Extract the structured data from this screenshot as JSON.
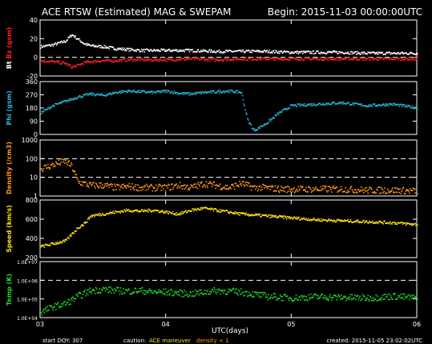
{
  "header": {
    "title": "ACE RTSW (Estimated) MAG & SWEPAM",
    "begin": "Begin: 2015-11-03 00:00:00UTC"
  },
  "footer": {
    "xlabel": "UTC(days)",
    "start_doy": "start DOY: 307",
    "caution_label": "caution:",
    "maneuver_label": "ACE maneuver",
    "density_label": "density < 1",
    "created": "created: 2015-11-05 23:02:02UTC"
  },
  "colors": {
    "background": "#000000",
    "frame": "#ffffff",
    "bz": "#ff2020",
    "bt": "#ffffff",
    "phi": "#29b6d8",
    "density": "#ff9a1a",
    "speed": "#ffe21a",
    "temp": "#22d82b",
    "maneuver": "#ffe21a",
    "density_caution": "#ff9a1a"
  },
  "chart_data": [
    {
      "type": "scatter",
      "panel": "bz-bt",
      "ylabel_parts": [
        "Bt",
        "Bz",
        "(gsm)"
      ],
      "ylabel_colors": [
        "#ffffff",
        "#ff2020",
        "#ff2020"
      ],
      "ylim": [
        -20,
        40
      ],
      "yticks": [
        -20,
        0,
        20,
        40
      ],
      "ytick_labels": [
        "-20",
        "0",
        "20",
        "40"
      ],
      "dashed_lines": [
        0
      ],
      "x": [
        3.0,
        3.1,
        3.2,
        3.25,
        3.3,
        3.35,
        3.4,
        3.5,
        3.6,
        3.7,
        3.8,
        3.9,
        4.0,
        4.2,
        4.4,
        4.6,
        4.8,
        5.0,
        5.2,
        5.4,
        5.6,
        5.8,
        6.0
      ],
      "series": [
        {
          "name": "Bt",
          "values": [
            12,
            14,
            18,
            25,
            20,
            15,
            13,
            12,
            10,
            9,
            8,
            8,
            8,
            8,
            7,
            7,
            7,
            6,
            6,
            6,
            5,
            5,
            5
          ]
        },
        {
          "name": "Bz",
          "values": [
            -3,
            -4,
            -6,
            -10,
            -8,
            -5,
            -4,
            -3,
            -3,
            -2,
            -2,
            -2,
            -2,
            -1,
            -2,
            -1,
            -1,
            -1,
            -1,
            -1,
            -1,
            -1,
            -1
          ]
        }
      ]
    },
    {
      "type": "scatter",
      "panel": "phi",
      "ylabel": "Phi (gsm)",
      "ylim": [
        0,
        360
      ],
      "yticks": [
        0,
        90,
        180,
        270,
        360
      ],
      "ytick_labels": [
        "0",
        "90",
        "180",
        "270",
        "360"
      ],
      "x": [
        3.0,
        3.1,
        3.2,
        3.3,
        3.4,
        3.5,
        3.6,
        3.7,
        3.8,
        3.9,
        4.0,
        4.1,
        4.2,
        4.3,
        4.4,
        4.5,
        4.6,
        4.65,
        4.7,
        4.8,
        4.9,
        5.0,
        5.2,
        5.4,
        5.6,
        5.8,
        6.0
      ],
      "series": [
        {
          "name": "Phi",
          "values": [
            150,
            200,
            230,
            260,
            280,
            270,
            290,
            300,
            295,
            290,
            300,
            285,
            280,
            290,
            295,
            300,
            290,
            100,
            30,
            80,
            150,
            200,
            210,
            220,
            200,
            210,
            185
          ]
        }
      ]
    },
    {
      "type": "scatter",
      "panel": "density",
      "ylabel": "Density (/cm3)",
      "yscale": "log",
      "ylim": [
        1,
        1000
      ],
      "yticks": [
        1,
        10,
        100,
        1000
      ],
      "ytick_labels": [
        "1",
        "10",
        "100",
        "1000"
      ],
      "dashed_lines": [
        10,
        100
      ],
      "x": [
        3.0,
        3.1,
        3.2,
        3.25,
        3.3,
        3.4,
        3.5,
        3.6,
        3.7,
        3.8,
        3.9,
        4.0,
        4.1,
        4.2,
        4.3,
        4.4,
        4.5,
        4.6,
        4.7,
        4.8,
        4.9,
        5.0,
        5.2,
        5.4,
        5.6,
        5.8,
        6.0
      ],
      "series": [
        {
          "name": "Density",
          "values": [
            30,
            50,
            80,
            40,
            6,
            4,
            4,
            3,
            3.5,
            3,
            3,
            3,
            4,
            3,
            5,
            4,
            3,
            5,
            3,
            3,
            2.5,
            2.5,
            2.5,
            2.5,
            2.2,
            2.2,
            2
          ]
        }
      ]
    },
    {
      "type": "scatter",
      "panel": "speed",
      "ylabel": "Speed (km/s)",
      "ylim": [
        200,
        800
      ],
      "yticks": [
        200,
        400,
        600,
        800
      ],
      "ytick_labels": [
        "200",
        "400",
        "600",
        "800"
      ],
      "x": [
        3.0,
        3.1,
        3.2,
        3.3,
        3.35,
        3.4,
        3.5,
        3.6,
        3.7,
        3.8,
        3.9,
        4.0,
        4.1,
        4.2,
        4.3,
        4.4,
        4.5,
        4.6,
        4.7,
        4.8,
        4.9,
        5.0,
        5.2,
        5.4,
        5.6,
        5.8,
        6.0
      ],
      "series": [
        {
          "name": "Speed",
          "values": [
            320,
            350,
            380,
            520,
            560,
            640,
            660,
            680,
            700,
            690,
            700,
            680,
            660,
            700,
            720,
            700,
            680,
            660,
            650,
            640,
            630,
            620,
            600,
            590,
            580,
            570,
            550
          ]
        }
      ]
    },
    {
      "type": "scatter",
      "panel": "temp",
      "ylabel": "Temp (K)",
      "yscale": "log",
      "ylim": [
        10000,
        10000000
      ],
      "yticks": [
        10000,
        100000,
        1000000,
        10000000
      ],
      "ytick_labels": [
        "1.0E+04",
        "1.0E+05",
        "1.0E+06",
        "1.0E+07"
      ],
      "dashed_lines": [
        1000000
      ],
      "x": [
        3.0,
        3.1,
        3.2,
        3.3,
        3.4,
        3.5,
        3.6,
        3.7,
        3.8,
        3.9,
        4.0,
        4.2,
        4.4,
        4.6,
        4.8,
        5.0,
        5.2,
        5.4,
        5.6,
        5.8,
        6.0
      ],
      "series": [
        {
          "name": "Temp",
          "values": [
            20000,
            40000,
            60000,
            150000,
            300000,
            350000,
            300000,
            280000,
            300000,
            250000,
            250000,
            200000,
            300000,
            250000,
            150000,
            120000,
            140000,
            130000,
            120000,
            150000,
            120000
          ]
        }
      ]
    }
  ],
  "x_axis": {
    "xlim": [
      3,
      6
    ],
    "ticks": [
      3,
      4,
      5,
      6
    ],
    "tick_labels": [
      "03",
      "04",
      "05",
      "06"
    ]
  }
}
